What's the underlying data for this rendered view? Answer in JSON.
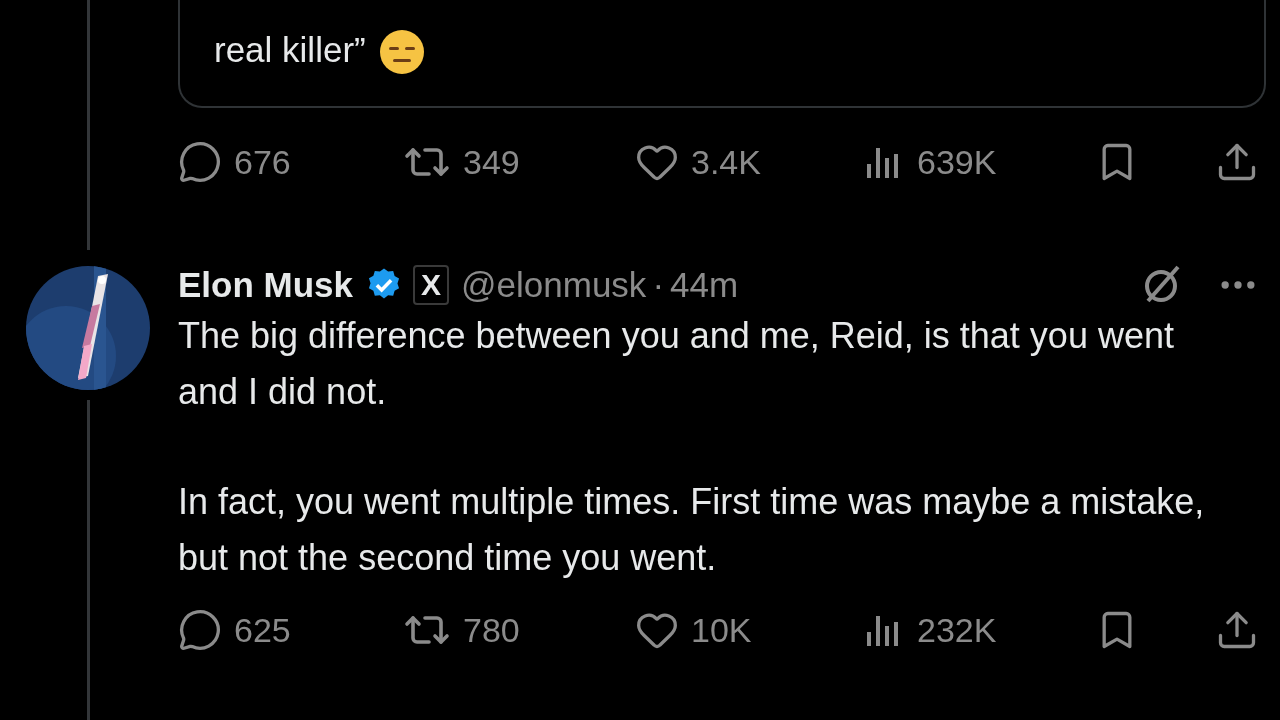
{
  "previous_tweet": {
    "quote_text": "real killer”",
    "stats": [
      {
        "kind": "reply",
        "count": "676"
      },
      {
        "kind": "repost",
        "count": "349"
      },
      {
        "kind": "like",
        "count": "3.4K"
      },
      {
        "kind": "views",
        "count": "639K"
      }
    ]
  },
  "tweet": {
    "author": "Elon Musk",
    "verified": true,
    "affiliation_badge": "X",
    "handle": "@elonmusk",
    "separator": "·",
    "time": "44m",
    "paragraphs": [
      "The big difference between you and me, Reid, is that you went and I did not.",
      "In fact, you went multiple times. First time was maybe a mistake, but not the second time you went."
    ],
    "stats": [
      {
        "kind": "reply",
        "count": "625"
      },
      {
        "kind": "repost",
        "count": "780"
      },
      {
        "kind": "like",
        "count": "10K"
      },
      {
        "kind": "views",
        "count": "232K"
      }
    ]
  }
}
